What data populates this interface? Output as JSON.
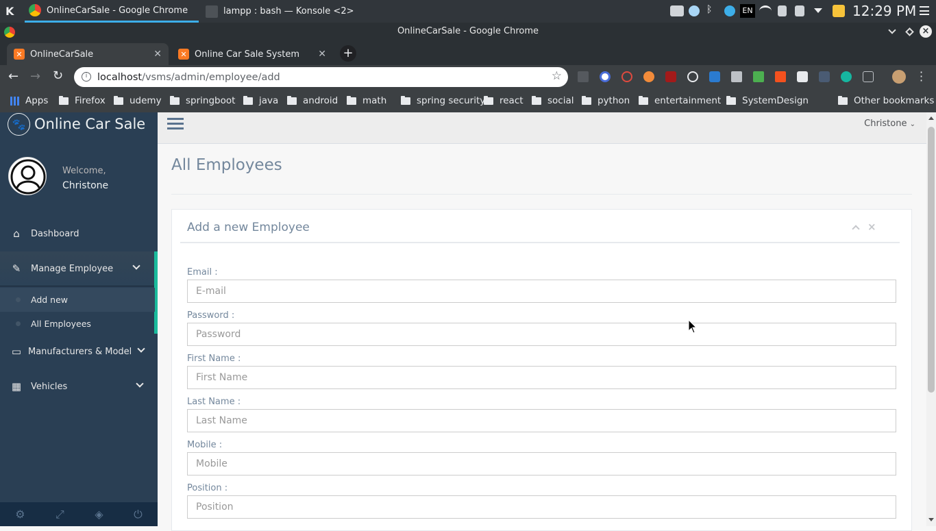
{
  "taskbar": {
    "tasks": [
      {
        "label": "OnlineCarSale - Google Chrome"
      },
      {
        "label": "lampp : bash — Konsole <2>"
      }
    ],
    "lang": "EN",
    "time": "12:29 PM"
  },
  "window": {
    "title": "OnlineCarSale - Google Chrome"
  },
  "tabs": [
    {
      "label": "OnlineCarSale"
    },
    {
      "label": "Online Car Sale System"
    }
  ],
  "address": {
    "host": "localhost",
    "path": "/vsms/admin/employee/add"
  },
  "bookmarks": {
    "apps": "Apps",
    "items": [
      "Firefox",
      "udemy",
      "springboot",
      "java",
      "android",
      "math",
      "spring security",
      "react",
      "social",
      "python",
      "entertainment",
      "SystemDesign"
    ],
    "other": "Other bookmarks"
  },
  "sidebar": {
    "brand": "Online Car Sale",
    "welcome": "Welcome,",
    "user": "Christone",
    "items": [
      {
        "label": "Dashboard",
        "icon": "home-icon"
      },
      {
        "label": "Manage Employee",
        "icon": "edit-icon"
      },
      {
        "label": "Manufacturers & Model",
        "icon": "desktop-icon"
      },
      {
        "label": "Vehicles",
        "icon": "table-icon"
      }
    ],
    "subitems": [
      "Add new",
      "All Employees"
    ]
  },
  "topnav": {
    "user": "Christone"
  },
  "page": {
    "title": "All Employees"
  },
  "panel": {
    "title": "Add a new Employee",
    "fields": [
      {
        "label": "Email :",
        "placeholder": "E-mail"
      },
      {
        "label": "Password :",
        "placeholder": "Password"
      },
      {
        "label": "First Name :",
        "placeholder": "First Name"
      },
      {
        "label": "Last Name :",
        "placeholder": "Last Name"
      },
      {
        "label": "Mobile :",
        "placeholder": "Mobile"
      },
      {
        "label": "Position :",
        "placeholder": "Position"
      }
    ]
  },
  "colors": {
    "sidebar": "#2a3f54",
    "accent": "#1abb9c",
    "chrome_dark": "#3c4043"
  }
}
